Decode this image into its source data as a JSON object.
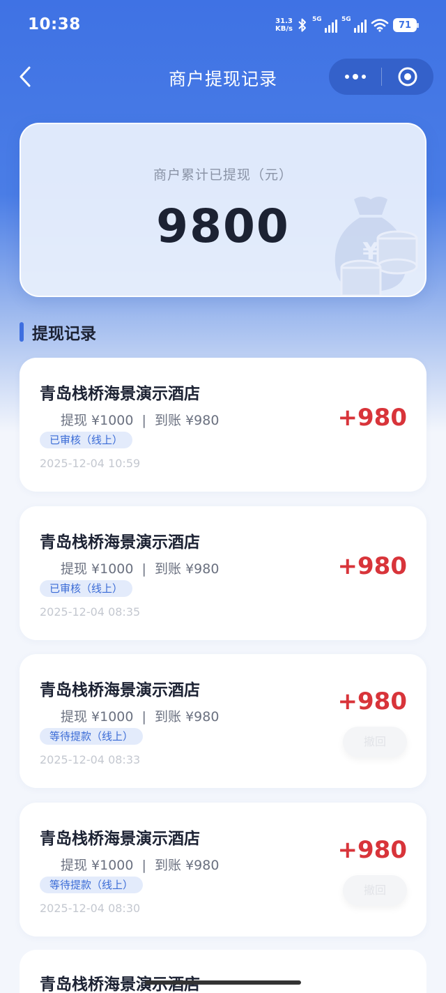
{
  "status_bar": {
    "time": "10:38",
    "net_speed_value": "31.3",
    "net_speed_unit": "KB/s",
    "signal1_label": "5G",
    "signal2_label": "5G",
    "battery": "71"
  },
  "nav": {
    "title": "商户提现记录"
  },
  "summary": {
    "label": "商户累计已提现（元）",
    "amount": "9800"
  },
  "section": {
    "title": "提现记录"
  },
  "records": [
    {
      "name": "青岛栈桥海景演示酒店",
      "detail": "提现 ¥1000  |  到账 ¥980",
      "status": "已审核（线上）",
      "time": "2025-12-04 10:59",
      "amount": "+980",
      "action": ""
    },
    {
      "name": "青岛栈桥海景演示酒店",
      "detail": "提现 ¥1000  |  到账 ¥980",
      "status": "已审核（线上）",
      "time": "2025-12-04 08:35",
      "amount": "+980",
      "action": ""
    },
    {
      "name": "青岛栈桥海景演示酒店",
      "detail": "提现 ¥1000  |  到账 ¥980",
      "status": "等待提款（线上）",
      "time": "2025-12-04 08:33",
      "amount": "+980",
      "action": "撤回"
    },
    {
      "name": "青岛栈桥海景演示酒店",
      "detail": "提现 ¥1000  |  到账 ¥980",
      "status": "等待提款（线上）",
      "time": "2025-12-04 08:30",
      "amount": "+980",
      "action": "撤回"
    }
  ],
  "peek_record": {
    "name": "青岛栈桥海景演示酒店"
  },
  "colors": {
    "primary": "#3f72e4",
    "amount_red": "#d8343a",
    "badge_bg": "#e3ebfb",
    "badge_text": "#3a6bd6"
  }
}
